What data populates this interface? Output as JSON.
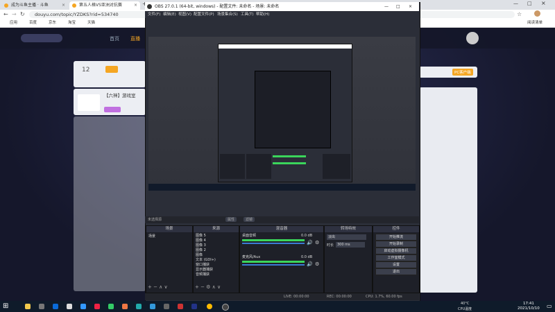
{
  "browser": {
    "tabs": [
      {
        "label": "成为斗鱼主播 · 斗鱼",
        "active": false
      },
      {
        "label": "第五人格VS亚洲对抗赛",
        "active": true
      }
    ],
    "new_tab": "+",
    "url": "douyu.com/topic/YZDKS?rid=534740",
    "bookmarks": [
      "应用",
      "百度",
      "京东",
      "淘宝",
      "天猫"
    ],
    "reading_list": "阅读清单"
  },
  "site": {
    "nav": [
      "首页",
      "直播"
    ],
    "room_viewers": "12",
    "streamer_name": "【六神】游戏室",
    "sidebar_right_label": "PC客户端"
  },
  "obs": {
    "title": "OBS 27.0.1 (64-bit, windows) - 配置文件: 未命名 - 场景: 未命名",
    "menu": [
      "文件(F)",
      "编辑(E)",
      "视图(V)",
      "配置文件(P)",
      "场景集合(S)",
      "工具(T)",
      "帮助(H)"
    ],
    "no_source": "未选择源",
    "props_button": "属性",
    "filter_button": "滤镜",
    "docks": {
      "scenes": "场景",
      "sources": "来源",
      "mixer": "混音器",
      "transitions": "转场特效",
      "controls": "控件"
    },
    "scene_items": [
      "场景"
    ],
    "source_items": [
      "图像 5",
      "图像 4",
      "图像 3",
      "图像 2",
      "图像",
      "文本 (GDI+)",
      "窗口捕获",
      "显示器捕获",
      "音频捕获"
    ],
    "mixer_tracks": [
      {
        "name": "桌面音频",
        "db": "0.0 dB"
      },
      {
        "name": "麦克风/Aux",
        "db": "0.0 dB"
      }
    ],
    "transition": {
      "type": "淡出",
      "duration_label": "时长",
      "duration_value": "300 ms"
    },
    "controls": [
      "开始推流",
      "开始录制",
      "启动虚拟摄像机",
      "工作室模式",
      "设置",
      "退出"
    ],
    "status": {
      "live": "LIVE: 00:00:00",
      "rec": "REC: 00:00:00",
      "cpu": "CPU: 1.7%, 60.00 fps"
    }
  },
  "taskbar": {
    "weather": "40°C",
    "weather_desc": "CPU温度",
    "time": "17:41",
    "date": "2021/10/10"
  },
  "colors": {
    "obs_bg": "#2b2e38",
    "accent_orange": "#f5a623",
    "meter_green": "#3bd65b",
    "meter_blue": "#3a7bd5"
  }
}
